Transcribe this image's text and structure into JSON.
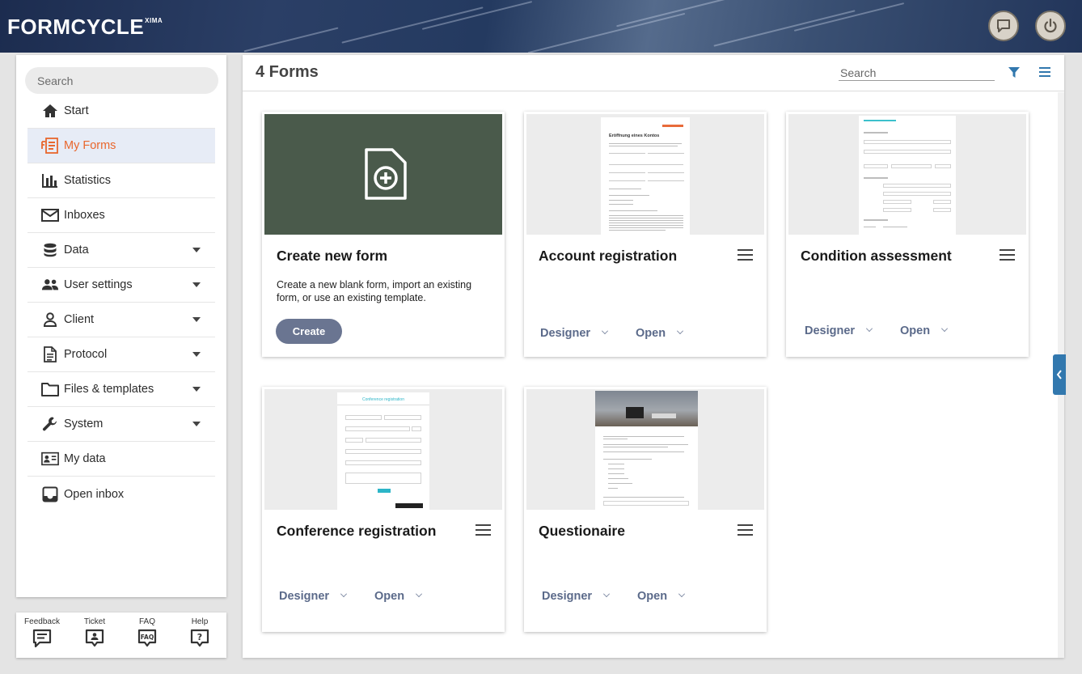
{
  "app": {
    "logo": "FORMCYCLE",
    "logo_suffix": "XIMA",
    "header_buttons": [
      {
        "name": "chat-icon"
      },
      {
        "name": "power-icon"
      }
    ]
  },
  "sidebar": {
    "search_placeholder": "Search",
    "items": [
      {
        "label": "Start",
        "icon": "home-icon",
        "active": false,
        "dropdown": false
      },
      {
        "label": "My Forms",
        "icon": "forms-icon",
        "active": true,
        "dropdown": false
      },
      {
        "label": "Statistics",
        "icon": "bar-chart-icon",
        "active": false,
        "dropdown": false
      },
      {
        "label": "Inboxes",
        "icon": "envelope-icon",
        "active": false,
        "dropdown": false
      },
      {
        "label": "Data",
        "icon": "database-icon",
        "active": false,
        "dropdown": true
      },
      {
        "label": "User settings",
        "icon": "users-icon",
        "active": false,
        "dropdown": true
      },
      {
        "label": "Client",
        "icon": "person-icon",
        "active": false,
        "dropdown": true
      },
      {
        "label": "Protocol",
        "icon": "document-icon",
        "active": false,
        "dropdown": true
      },
      {
        "label": "Files & templates",
        "icon": "folder-icon",
        "active": false,
        "dropdown": true
      },
      {
        "label": "System",
        "icon": "wrench-icon",
        "active": false,
        "dropdown": true
      },
      {
        "label": "My data",
        "icon": "id-card-icon",
        "active": false,
        "dropdown": false
      },
      {
        "label": "Open inbox",
        "icon": "inbox-icon",
        "active": false,
        "dropdown": false
      }
    ],
    "help": [
      {
        "label": "Feedback",
        "icon": "feedback-icon"
      },
      {
        "label": "Ticket",
        "icon": "ticket-icon"
      },
      {
        "label": "FAQ",
        "icon": "faq-icon",
        "badge": "FAQ"
      },
      {
        "label": "Help",
        "icon": "help-icon",
        "badge": "?"
      }
    ]
  },
  "main": {
    "title": "4 Forms",
    "search_placeholder": "Search",
    "create_card": {
      "title": "Create new form",
      "description": "Create a new blank form, import an existing form, or use an existing template.",
      "button": "Create"
    },
    "forms": [
      {
        "title": "Account registration",
        "designer": "Designer",
        "open": "Open",
        "thumb_heading": "Eröffnung eines Kontos"
      },
      {
        "title": "Condition assessment",
        "designer": "Designer",
        "open": "Open"
      },
      {
        "title": "Conference registration",
        "designer": "Designer",
        "open": "Open",
        "thumb_heading": "Conference registration"
      },
      {
        "title": "Questionaire",
        "designer": "Designer",
        "open": "Open"
      }
    ]
  },
  "colors": {
    "accent_orange": "#e8672d",
    "action_blue": "#5b6a8a",
    "create_button": "#6a7591",
    "thumb_dark_green": "#4a5a4b",
    "side_tab": "#3278ae",
    "filter_icon": "#3278ae"
  }
}
